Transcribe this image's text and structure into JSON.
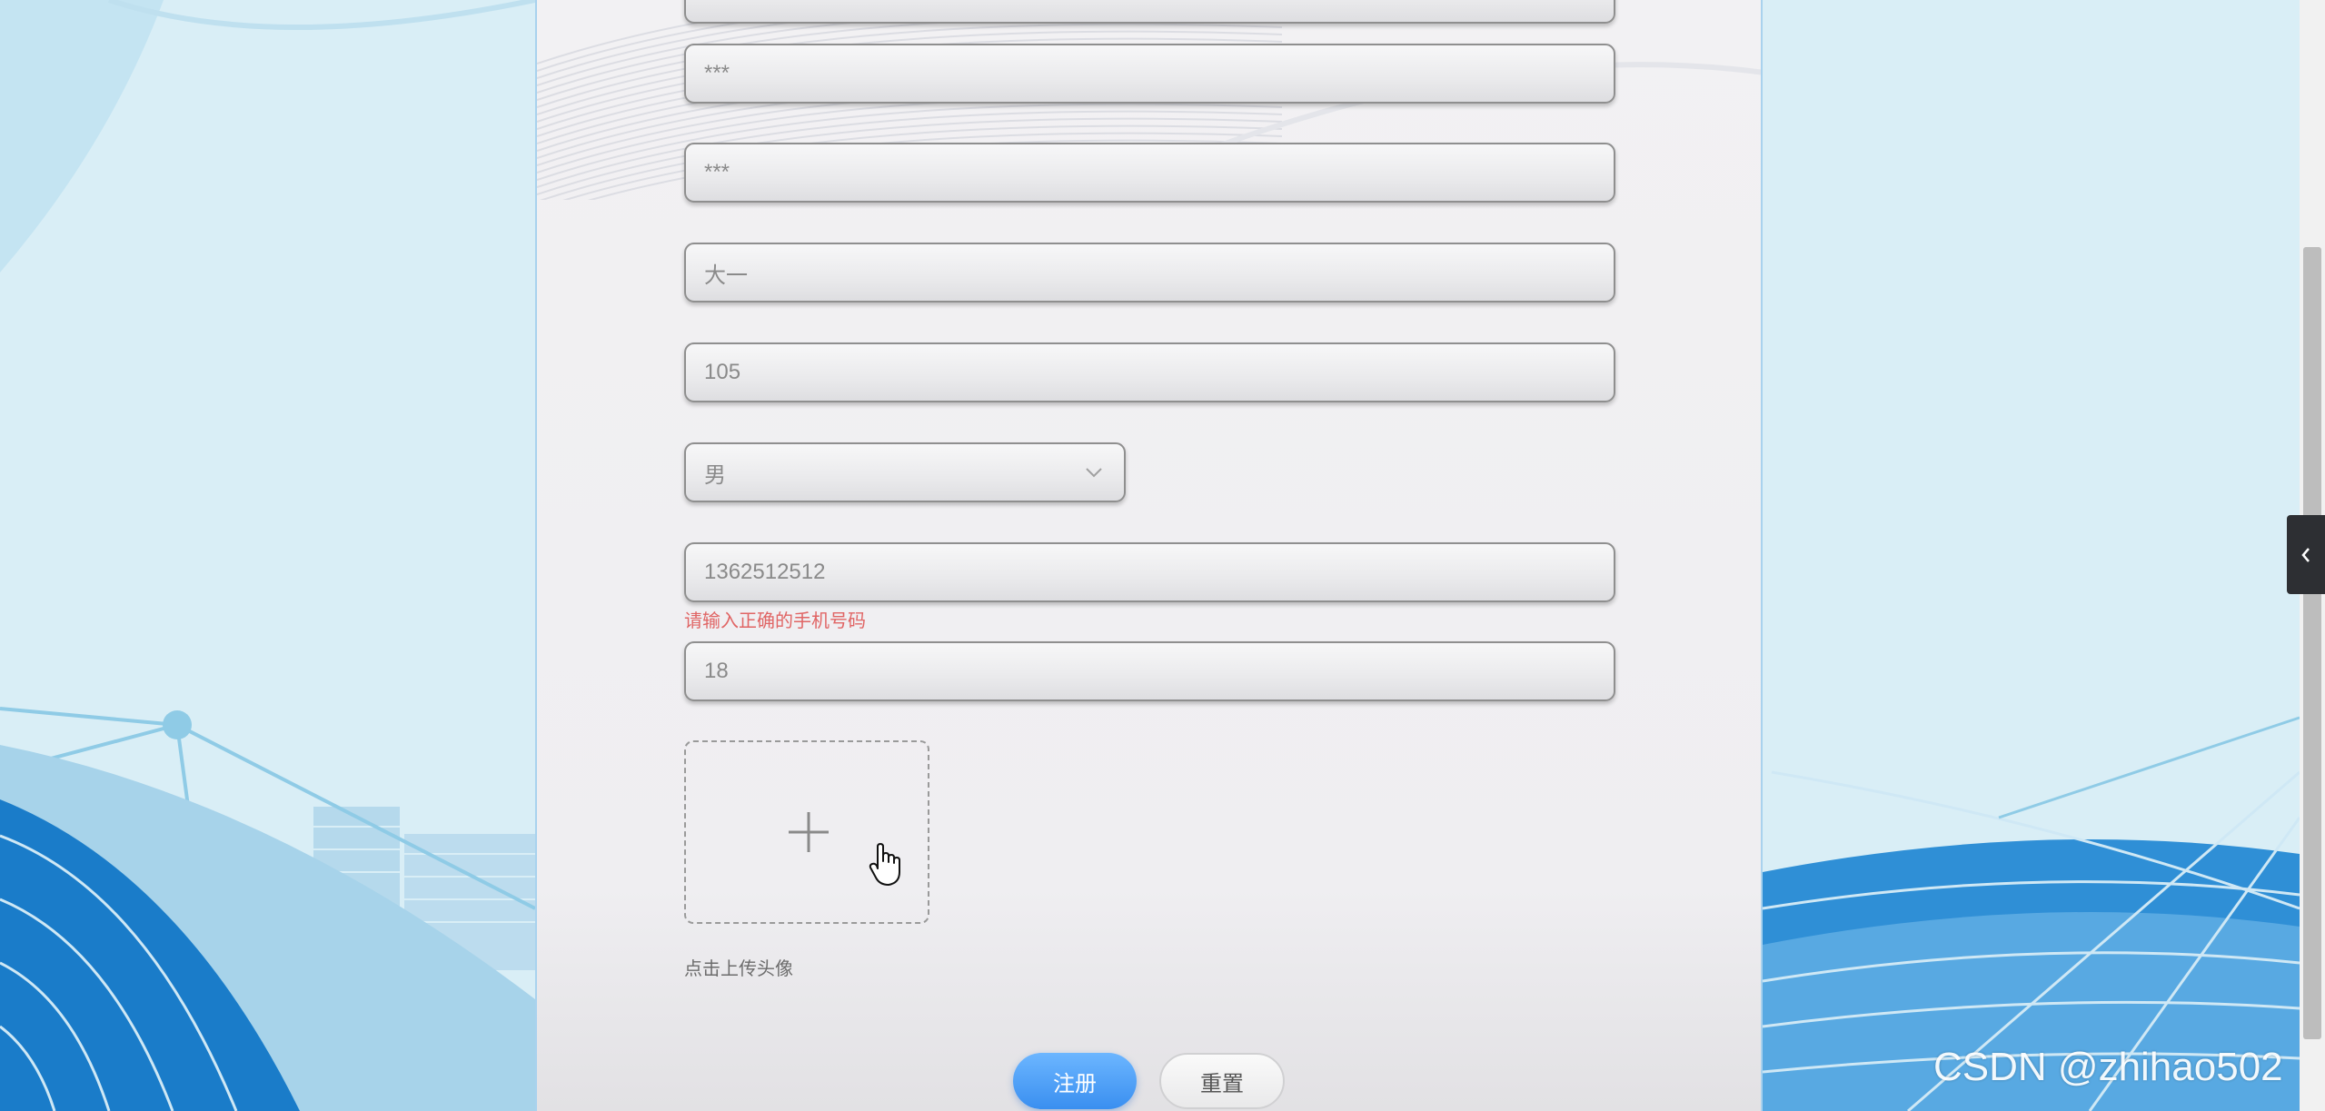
{
  "form": {
    "fields": [
      {
        "name": "password-field",
        "value": "***"
      },
      {
        "name": "confirm-password-field",
        "value": "***"
      },
      {
        "name": "grade-field",
        "value": "大一"
      },
      {
        "name": "class-field",
        "value": "105"
      },
      {
        "name": "phone-field",
        "value": "1362512512"
      },
      {
        "name": "age-field",
        "value": "18"
      }
    ],
    "gender_select": {
      "value": "男",
      "icon": "chevron-down-icon"
    },
    "phone_error": "请输入正确的手机号码",
    "upload": {
      "icon": "plus-icon",
      "hint": "点击上传头像"
    },
    "buttons": {
      "register": "注册",
      "reset": "重置"
    }
  },
  "side_tab": {
    "icon": "chevron-left-icon"
  },
  "watermark": "CSDN @zhihao502",
  "colors": {
    "primary": "#409eff",
    "error": "#e06565",
    "backdrop": "#d8edf5",
    "wave": "#2f8fd6"
  }
}
